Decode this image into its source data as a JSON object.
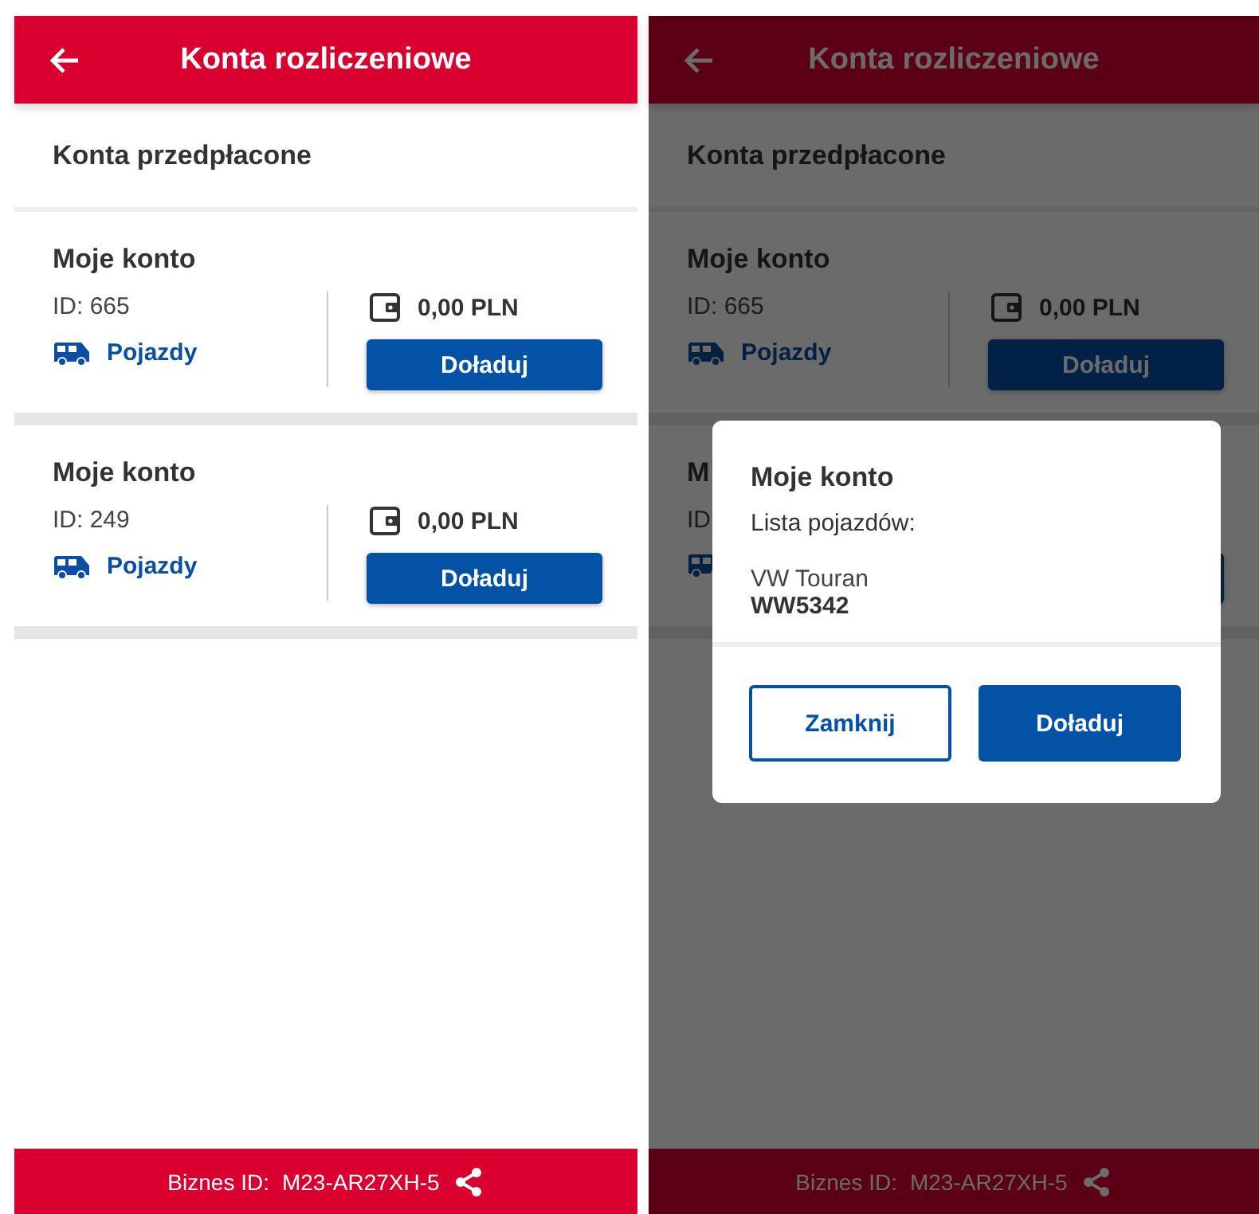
{
  "screens": [
    {
      "dimmed": false,
      "header": {
        "title": "Konta rozliczeniowe"
      },
      "section_title": "Konta przedpłacone",
      "accounts": [
        {
          "name": "Moje konto",
          "id": "ID: 665",
          "vehicles_link": "Pojazdy",
          "balance": "0,00 PLN",
          "button": "Doładuj"
        },
        {
          "name": "Moje konto",
          "id": "ID: 249",
          "vehicles_link": "Pojazdy",
          "balance": "0,00 PLN",
          "button": "Doładuj"
        }
      ],
      "footer": {
        "label": "Biznes ID:",
        "value": "M23-AR27XH-5"
      }
    },
    {
      "dimmed": true,
      "header": {
        "title": "Konta rozliczeniowe"
      },
      "section_title": "Konta przedpłacone",
      "accounts": [
        {
          "name": "Moje konto",
          "id": "ID: 665",
          "vehicles_link": "Pojazdy",
          "balance": "0,00 PLN",
          "button": "Doładuj"
        },
        {
          "name": "M",
          "id": "ID"
        }
      ],
      "footer": {
        "label": "Biznes ID:",
        "value": "M23-AR27XH-5"
      },
      "dialog": {
        "title": "Moje konto",
        "subtitle": "Lista pojazdów:",
        "vehicles": [
          {
            "model": "VW Touran",
            "plate": "WW5342"
          }
        ],
        "buttons": [
          {
            "label": "Zamknij",
            "kind": "outline"
          },
          {
            "label": "Doładuj",
            "kind": "filled"
          }
        ]
      }
    }
  ]
}
